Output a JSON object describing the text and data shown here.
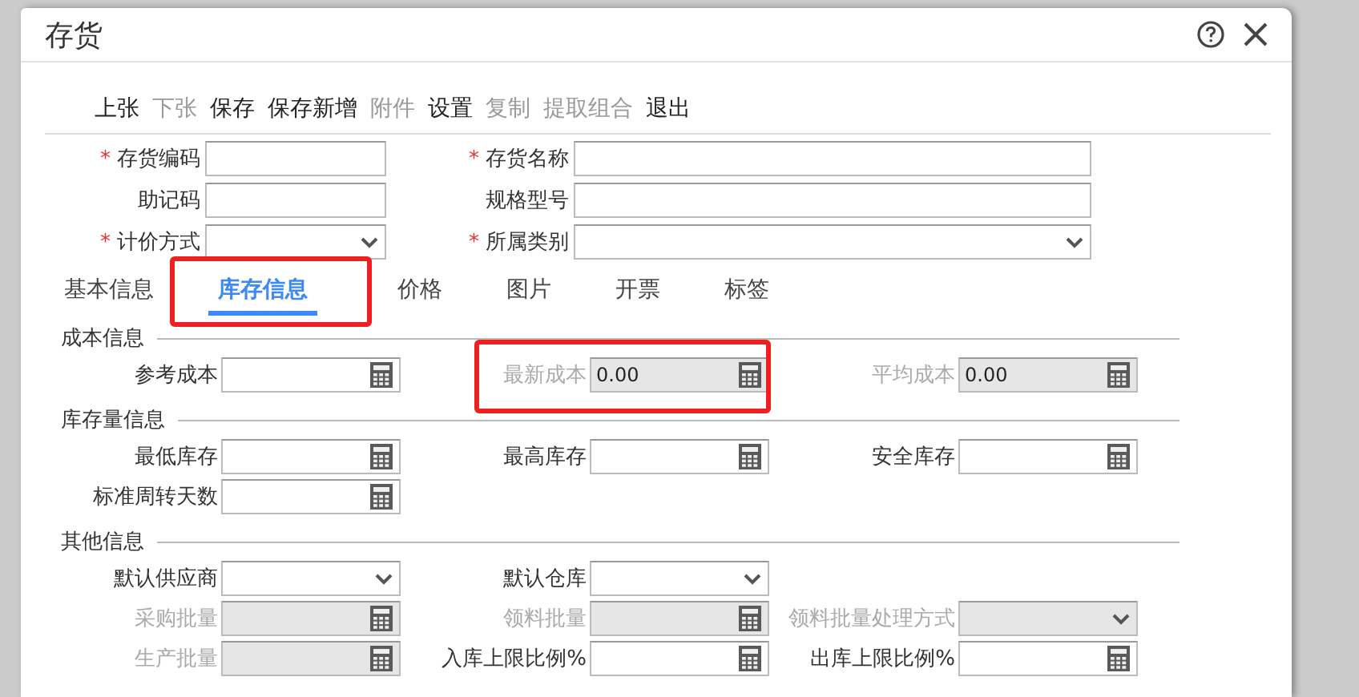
{
  "window": {
    "title": "存货"
  },
  "toolbar": [
    {
      "label": "上张",
      "disabled": false
    },
    {
      "label": "下张",
      "disabled": true
    },
    {
      "label": "保存",
      "disabled": false
    },
    {
      "label": "保存新增",
      "disabled": false
    },
    {
      "label": "附件",
      "disabled": true
    },
    {
      "label": "设置",
      "disabled": false
    },
    {
      "label": "复制",
      "disabled": true
    },
    {
      "label": "提取组合",
      "disabled": true
    },
    {
      "label": "退出",
      "disabled": false
    }
  ],
  "header_fields": [
    [
      {
        "label": "存货编码",
        "mark": "*",
        "kind": "text",
        "disabled": false
      },
      {
        "label": "存货名称",
        "mark": "*",
        "kind": "text",
        "disabled": false
      }
    ],
    [
      {
        "label": "助记码",
        "kind": "text",
        "disabled": false
      },
      {
        "label": "规格型号",
        "kind": "text",
        "disabled": false
      }
    ],
    [
      {
        "label": "计价方式",
        "mark": "*",
        "kind": "select",
        "disabled": false
      },
      {
        "label": "所属类别",
        "mark": "*",
        "kind": "select",
        "disabled": false
      }
    ]
  ],
  "tabs": [
    {
      "label": "基本信息",
      "selected": false,
      "highlighted": false
    },
    {
      "label": "库存信息",
      "selected": true,
      "highlighted": true
    },
    {
      "label": "价格",
      "selected": false,
      "highlighted": false
    },
    {
      "label": "图片",
      "selected": false,
      "highlighted": false
    },
    {
      "label": "开票",
      "selected": false,
      "highlighted": false
    },
    {
      "label": "标签",
      "selected": false,
      "highlighted": false
    }
  ],
  "sections": [
    {
      "title": "成本信息",
      "rows": [
        [
          {
            "label": "参考成本",
            "kind": "calc",
            "disabled": false,
            "highlighted": false
          },
          {
            "label": "最新成本",
            "kind": "calc",
            "disabled": true,
            "value": "0.00",
            "highlighted": true
          },
          {
            "label": "平均成本",
            "kind": "calc",
            "disabled": true,
            "value": "0.00",
            "highlighted": false
          }
        ]
      ]
    },
    {
      "title": "库存量信息",
      "rows": [
        [
          {
            "label": "最低库存",
            "kind": "calc",
            "disabled": false,
            "highlighted": false
          },
          {
            "label": "最高库存",
            "kind": "calc",
            "disabled": false,
            "highlighted": false
          },
          {
            "label": "安全库存",
            "kind": "calc",
            "disabled": false,
            "highlighted": false
          }
        ],
        [
          {
            "label": "标准周转天数",
            "kind": "calc",
            "disabled": false,
            "highlighted": false
          }
        ]
      ]
    },
    {
      "title": "其他信息",
      "rows": [
        [
          {
            "label": "默认供应商",
            "kind": "select",
            "disabled": false,
            "highlighted": false
          },
          {
            "label": "默认仓库",
            "kind": "select",
            "disabled": false,
            "highlighted": false
          }
        ],
        [
          {
            "label": "采购批量",
            "kind": "calc",
            "disabled": true,
            "highlighted": false
          },
          {
            "label": "领料批量",
            "kind": "calc",
            "disabled": true,
            "highlighted": false
          },
          {
            "label": "领料批量处理方式",
            "kind": "select",
            "disabled": true,
            "highlighted": false
          }
        ],
        [
          {
            "label": "生产批量",
            "kind": "calc",
            "disabled": true,
            "highlighted": false
          },
          {
            "label": "入库上限比例%",
            "kind": "calc",
            "disabled": false,
            "highlighted": false
          },
          {
            "label": "出库上限比例%",
            "kind": "calc",
            "disabled": false,
            "highlighted": false
          }
        ]
      ]
    }
  ]
}
